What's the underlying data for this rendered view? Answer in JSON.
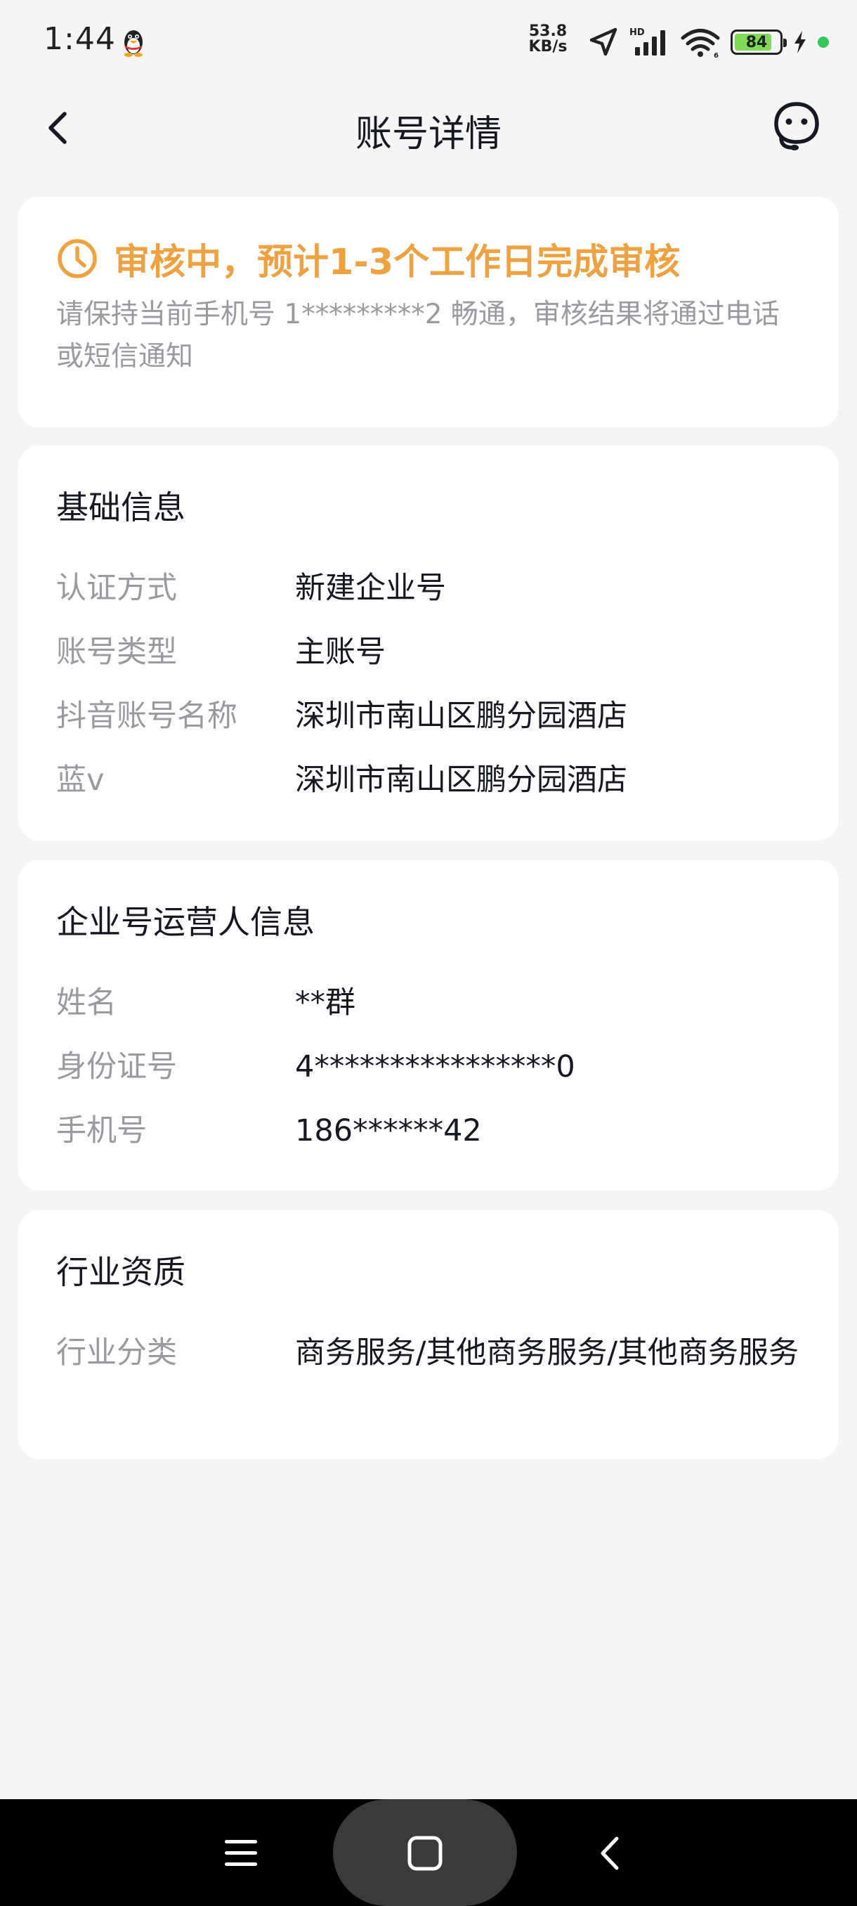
{
  "status_bar": {
    "time": "1:44",
    "speed_top": "53.8",
    "speed_bottom": "KB/s",
    "network_label": "HD",
    "battery_level": "84",
    "battery_fraction": 0.84
  },
  "nav": {
    "title": "账号详情"
  },
  "review": {
    "title": "审核中，预计1-3个工作日完成审核",
    "description": "请保持当前手机号 1*********2 畅通，审核结果将通过电话或短信通知",
    "accent_color": "#f0a240"
  },
  "basic_info": {
    "heading": "基础信息",
    "rows": [
      {
        "label": "认证方式",
        "value": "新建企业号"
      },
      {
        "label": "账号类型",
        "value": "主账号"
      },
      {
        "label": "抖音账号名称",
        "value": "深圳市南山区鹏分园酒店"
      },
      {
        "label": "蓝v",
        "value": "深圳市南山区鹏分园酒店"
      }
    ]
  },
  "operator_info": {
    "heading": "企业号运营人信息",
    "rows": [
      {
        "label": "姓名",
        "value": "**群"
      },
      {
        "label": "身份证号",
        "value": "4****************0"
      },
      {
        "label": "手机号",
        "value": "186******42"
      }
    ]
  },
  "industry_info": {
    "heading": "行业资质",
    "rows": [
      {
        "label": "行业分类",
        "value": "商务服务/其他商务服务/其他商务服务"
      }
    ]
  },
  "icons": {
    "status": [
      "qq-penguin-icon",
      "location-arrow-icon",
      "cellular-signal-icon",
      "wifi-icon",
      "battery-icon",
      "charging-bolt-icon"
    ],
    "nav": [
      "back-arrow-icon",
      "customer-service-icon"
    ],
    "system": [
      "menu-icon",
      "home-icon",
      "back-icon"
    ]
  }
}
